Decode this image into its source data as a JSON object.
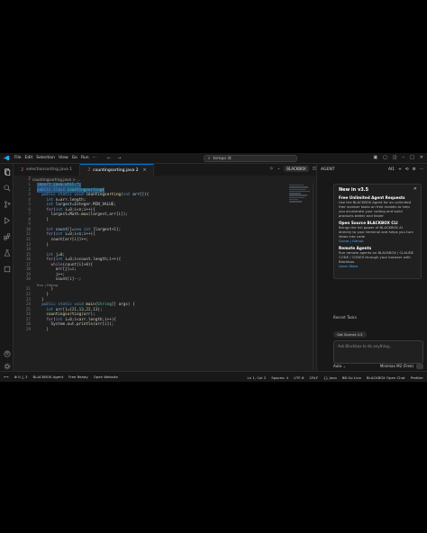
{
  "titlebar": {
    "menu": [
      "File",
      "Edit",
      "Selection",
      "View",
      "Go",
      "Run"
    ],
    "search_text": "tempo lit"
  },
  "tabs": [
    {
      "label": "selectionsorting.java 1",
      "active": false
    },
    {
      "label": "countingsorting.java 2",
      "active": true
    }
  ],
  "editor_actions": {
    "blackbox": "BLACKBOX"
  },
  "breadcrumb": "countingsorting.java > ...",
  "code": {
    "line_numbers": [
      "1",
      "2",
      "3",
      "4",
      "5",
      "6",
      "7",
      "8",
      "9",
      "10",
      "11",
      "12",
      "13",
      "14",
      "15",
      "16",
      "17",
      "18",
      "19",
      "20",
      "21",
      "22",
      "23",
      "24",
      "25",
      "26",
      "27",
      "28",
      "29"
    ],
    "codelens": "Run | Debug"
  },
  "panel": {
    "header_title": "AGENT",
    "header_tag": "AI1",
    "card": {
      "title": "New in v3.5",
      "s1_title": "Free Unlimited Agent Requests",
      "s1_text": "Use the BLACKBOX Agent for an unlimited free number tasks on free models to help you accelerate your coding and build products better and faster",
      "s2_title": "Open Source BLACKBOX CLI",
      "s2_text": "Brings the full power of BLACKBOX AI directly to your terminal and helps you turn ideas into code",
      "s2_links": "Guide | Github",
      "s3_title": "Remote Agents",
      "s3_text": "Run remote agents on BLACKBOX / CLAUDE CODE / CODEX through your browser with Blackbox.",
      "s3_link": "Learn More"
    },
    "recent_tasks": "Recent Tasks",
    "task_chip": "Get Sonnet 4.5",
    "chat_placeholder": "Ask Blackbox to do anything...",
    "mode": "Auto",
    "model": "Minimax M2 (Free)"
  },
  "statusbar": {
    "left": [
      "⊗ 0 △ 3",
      "BLACKBOX Agent",
      "Free Ready",
      "Open Website"
    ],
    "right": [
      "Ln 1, Col 2",
      "Spaces: 4",
      "UTF-8",
      "CRLF",
      "{} Java",
      "BB Go Live",
      "BLACKBOX Open Chat",
      "Prettier"
    ]
  },
  "colors": {
    "accent": "#0078d4",
    "bg": "#1f1f1f",
    "java_icon": "#e06c4c"
  }
}
